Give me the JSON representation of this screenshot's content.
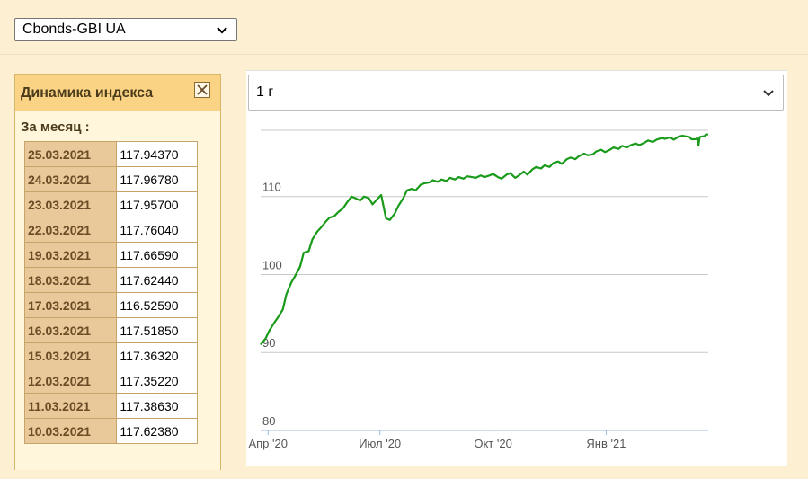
{
  "index_select": {
    "selected": "Cbonds-GBI UA"
  },
  "panel": {
    "title": "Динамика индекса",
    "month_label": "За месяц :",
    "rows": [
      {
        "date": "25.03.2021",
        "value": "117.94370"
      },
      {
        "date": "24.03.2021",
        "value": "117.96780"
      },
      {
        "date": "23.03.2021",
        "value": "117.95700"
      },
      {
        "date": "22.03.2021",
        "value": "117.76040"
      },
      {
        "date": "19.03.2021",
        "value": "117.66590"
      },
      {
        "date": "18.03.2021",
        "value": "117.62440"
      },
      {
        "date": "17.03.2021",
        "value": "116.52590"
      },
      {
        "date": "16.03.2021",
        "value": "117.51850"
      },
      {
        "date": "15.03.2021",
        "value": "117.36320"
      },
      {
        "date": "12.03.2021",
        "value": "117.35220"
      },
      {
        "date": "11.03.2021",
        "value": "117.38630"
      },
      {
        "date": "10.03.2021",
        "value": "117.62380"
      }
    ]
  },
  "period_select": {
    "selected": "1 г"
  },
  "colors": {
    "line": "#1a9a1a",
    "grid": "#c8c8c8",
    "axis": "#9ab8d8",
    "label": "#555555"
  },
  "chart_data": {
    "type": "line",
    "title": "",
    "xlabel": "",
    "ylabel": "",
    "ylim": [
      80,
      118.5
    ],
    "yticks": [
      80,
      90,
      100,
      110
    ],
    "xtick_labels": [
      "Апр '20",
      "Июл '20",
      "Окт '20",
      "Янв '21"
    ],
    "series": [
      {
        "points": [
          [
            "2020-03-26",
            91.0
          ],
          [
            "2020-03-30",
            91.8
          ],
          [
            "2020-04-02",
            92.8
          ],
          [
            "2020-04-06",
            93.8
          ],
          [
            "2020-04-09",
            94.5
          ],
          [
            "2020-04-13",
            95.5
          ],
          [
            "2020-04-16",
            97.5
          ],
          [
            "2020-04-20",
            99.0
          ],
          [
            "2020-04-23",
            99.8
          ],
          [
            "2020-04-27",
            101.0
          ],
          [
            "2020-04-30",
            102.8
          ],
          [
            "2020-05-04",
            103.0
          ],
          [
            "2020-05-07",
            104.5
          ],
          [
            "2020-05-11",
            105.5
          ],
          [
            "2020-05-14",
            106.0
          ],
          [
            "2020-05-18",
            106.8
          ],
          [
            "2020-05-21",
            107.3
          ],
          [
            "2020-05-25",
            107.5
          ],
          [
            "2020-05-28",
            108.0
          ],
          [
            "2020-06-01",
            108.5
          ],
          [
            "2020-06-04",
            109.2
          ],
          [
            "2020-06-08",
            110.0
          ],
          [
            "2020-06-11",
            109.8
          ],
          [
            "2020-06-15",
            109.5
          ],
          [
            "2020-06-18",
            110.0
          ],
          [
            "2020-06-22",
            109.8
          ],
          [
            "2020-06-25",
            109.0
          ],
          [
            "2020-06-29",
            109.7
          ],
          [
            "2020-07-02",
            110.2
          ],
          [
            "2020-07-06",
            107.2
          ],
          [
            "2020-07-09",
            107.0
          ],
          [
            "2020-07-13",
            107.8
          ],
          [
            "2020-07-16",
            108.8
          ],
          [
            "2020-07-20",
            109.8
          ],
          [
            "2020-07-23",
            110.8
          ],
          [
            "2020-07-27",
            111.0
          ],
          [
            "2020-07-30",
            110.8
          ],
          [
            "2020-08-03",
            111.5
          ],
          [
            "2020-08-06",
            111.7
          ],
          [
            "2020-08-10",
            111.8
          ],
          [
            "2020-08-13",
            112.1
          ],
          [
            "2020-08-17",
            111.9
          ],
          [
            "2020-08-20",
            112.2
          ],
          [
            "2020-08-24",
            112.0
          ],
          [
            "2020-08-27",
            112.4
          ],
          [
            "2020-08-31",
            112.2
          ],
          [
            "2020-09-03",
            112.5
          ],
          [
            "2020-09-07",
            112.3
          ],
          [
            "2020-09-10",
            112.6
          ],
          [
            "2020-09-14",
            112.5
          ],
          [
            "2020-09-17",
            112.4
          ],
          [
            "2020-09-21",
            112.7
          ],
          [
            "2020-09-24",
            112.5
          ],
          [
            "2020-09-28",
            112.7
          ],
          [
            "2020-10-01",
            112.9
          ],
          [
            "2020-10-05",
            112.5
          ],
          [
            "2020-10-08",
            112.3
          ],
          [
            "2020-10-12",
            112.8
          ],
          [
            "2020-10-15",
            113.0
          ],
          [
            "2020-10-19",
            112.4
          ],
          [
            "2020-10-22",
            112.7
          ],
          [
            "2020-10-26",
            113.2
          ],
          [
            "2020-10-29",
            112.8
          ],
          [
            "2020-11-02",
            113.5
          ],
          [
            "2020-11-05",
            113.8
          ],
          [
            "2020-11-09",
            113.6
          ],
          [
            "2020-11-12",
            114.0
          ],
          [
            "2020-11-16",
            113.8
          ],
          [
            "2020-11-19",
            114.3
          ],
          [
            "2020-11-23",
            114.5
          ],
          [
            "2020-11-26",
            114.2
          ],
          [
            "2020-11-30",
            114.8
          ],
          [
            "2020-12-03",
            115.0
          ],
          [
            "2020-12-07",
            114.8
          ],
          [
            "2020-12-10",
            115.2
          ],
          [
            "2020-12-14",
            115.5
          ],
          [
            "2020-12-17",
            115.3
          ],
          [
            "2020-12-21",
            115.4
          ],
          [
            "2020-12-24",
            115.8
          ],
          [
            "2020-12-28",
            116.0
          ],
          [
            "2020-12-31",
            115.7
          ],
          [
            "2021-01-04",
            116.0
          ],
          [
            "2021-01-07",
            116.3
          ],
          [
            "2021-01-11",
            116.1
          ],
          [
            "2021-01-14",
            116.5
          ],
          [
            "2021-01-18",
            116.3
          ],
          [
            "2021-01-21",
            116.6
          ],
          [
            "2021-01-25",
            116.8
          ],
          [
            "2021-01-28",
            116.6
          ],
          [
            "2021-02-01",
            116.9
          ],
          [
            "2021-02-04",
            117.2
          ],
          [
            "2021-02-08",
            117.0
          ],
          [
            "2021-02-11",
            117.3
          ],
          [
            "2021-02-15",
            117.5
          ],
          [
            "2021-02-18",
            117.4
          ],
          [
            "2021-02-22",
            117.6
          ],
          [
            "2021-02-25",
            117.3
          ],
          [
            "2021-03-01",
            117.7
          ],
          [
            "2021-03-04",
            117.8
          ],
          [
            "2021-03-10",
            117.6238
          ],
          [
            "2021-03-11",
            117.3863
          ],
          [
            "2021-03-12",
            117.3522
          ],
          [
            "2021-03-15",
            117.3632
          ],
          [
            "2021-03-16",
            117.5185
          ],
          [
            "2021-03-17",
            116.5259
          ],
          [
            "2021-03-18",
            117.6244
          ],
          [
            "2021-03-19",
            117.6659
          ],
          [
            "2021-03-22",
            117.7604
          ],
          [
            "2021-03-23",
            117.957
          ],
          [
            "2021-03-24",
            117.9678
          ],
          [
            "2021-03-25",
            117.9437
          ]
        ]
      }
    ]
  }
}
